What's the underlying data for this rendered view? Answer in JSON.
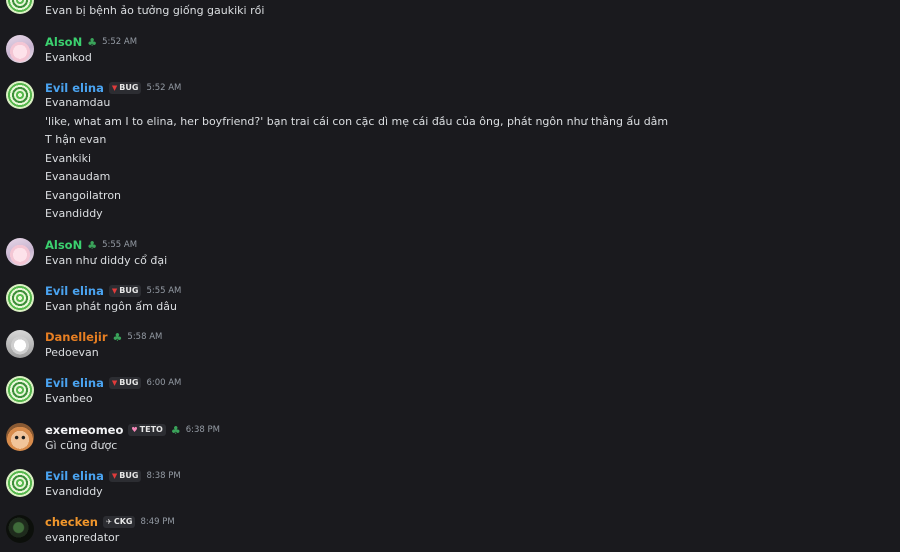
{
  "messages": [
    {
      "avatar": "spiral-avatar",
      "username": "",
      "lines": [
        "Evan bị bệnh ảo tưởng giống gaukiki rồi"
      ]
    },
    {
      "avatar": "anime-avatar",
      "username": "AlsoN",
      "badge": "leaf-icon",
      "time": "5:52 AM",
      "lines": [
        "Evankod"
      ]
    },
    {
      "avatar": "spiral-avatar",
      "username": "Evil elina",
      "tag": "BUG",
      "time": "5:52 AM",
      "lines": [
        "Evanamdau",
        "'like, what am I to elina, her boyfriend?' bạn trai cái con cặc dì mẹ cái đầu của ông, phát ngôn như thằng ấu dâm",
        "T hận evan",
        "Evankiki",
        "Evanaudam",
        "Evangoilatron",
        "Evandiddy"
      ]
    },
    {
      "avatar": "anime-avatar",
      "username": "AlsoN",
      "badge": "leaf-icon",
      "time": "5:55 AM",
      "lines": [
        "Evan như diddy cổ đại"
      ]
    },
    {
      "avatar": "spiral-avatar",
      "username": "Evil elina",
      "tag": "BUG",
      "time": "5:55 AM",
      "lines": [
        "Evan phát ngôn ấm dâu"
      ]
    },
    {
      "avatar": "gray-avatar",
      "username": "Danellejir",
      "badge": "leaf-icon",
      "time": "5:58 AM",
      "lines": [
        "Pedoevan"
      ]
    },
    {
      "avatar": "spiral-avatar",
      "username": "Evil elina",
      "tag": "BUG",
      "time": "6:00 AM",
      "lines": [
        "Evanbeo"
      ]
    },
    {
      "avatar": "cat-avatar",
      "username": "exemeomeo",
      "tag": "TETO",
      "badge": "leaf-icon",
      "time": "6:38 PM",
      "lines": [
        "Gì cũng được"
      ]
    },
    {
      "avatar": "spiral-avatar",
      "username": "Evil elina",
      "tag": "BUG",
      "time": "8:38 PM",
      "lines": [
        "Evandiddy"
      ]
    },
    {
      "avatar": "dark-avatar",
      "username": "checken",
      "tag": "CKG",
      "time": "8:49 PM",
      "lines": [
        "evanpredator"
      ]
    }
  ]
}
